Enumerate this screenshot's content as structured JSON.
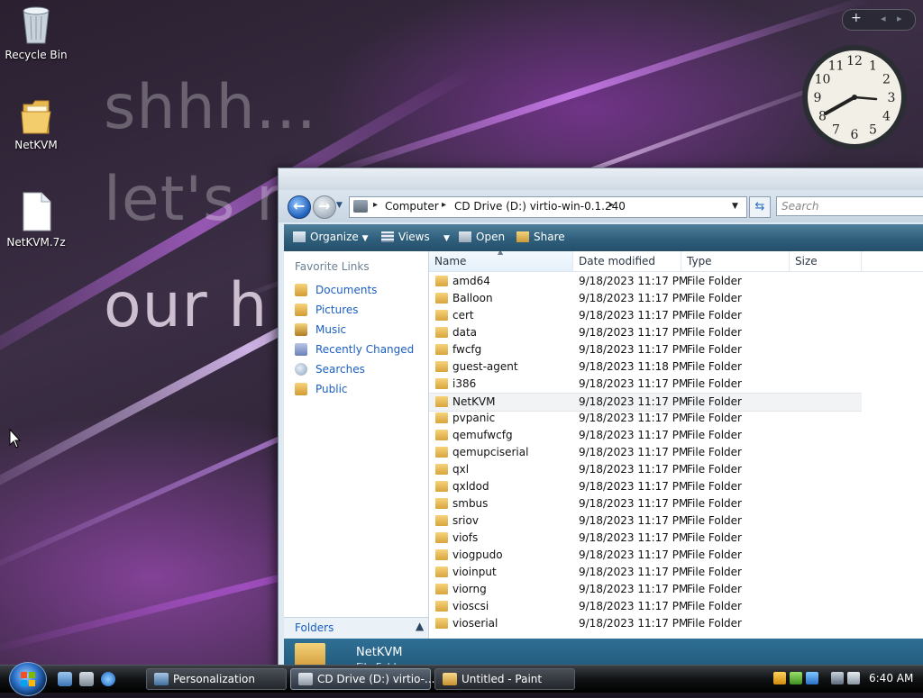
{
  "wallpaper": {
    "lines": [
      "shhh...",
      "let's n",
      "our h"
    ]
  },
  "desktop": {
    "icons": [
      {
        "label": "Recycle Bin",
        "icon": "recycle-bin-icon"
      },
      {
        "label": "NetKVM",
        "icon": "folder-icon"
      },
      {
        "label": "NetKVM.7z",
        "icon": "file-icon"
      }
    ]
  },
  "gadgets": {
    "bar": {
      "add": "+",
      "prev": "◂",
      "next": "▸"
    },
    "clock": {
      "numerals": [
        "12",
        "1",
        "2",
        "3",
        "4",
        "5",
        "6",
        "7",
        "8",
        "9",
        "10",
        "11"
      ]
    }
  },
  "explorer": {
    "address": {
      "root_icon": "computer-icon",
      "crumbs": [
        "Computer",
        "CD Drive (D:) virtio-win-0.1.240"
      ]
    },
    "search_placeholder": "Search",
    "toolbar": {
      "organize": "Organize",
      "views": "Views",
      "open": "Open",
      "share": "Share"
    },
    "nav_pane": {
      "section": "Favorite Links",
      "links": [
        {
          "label": "Documents",
          "icon": "documents-icon"
        },
        {
          "label": "Pictures",
          "icon": "pictures-icon"
        },
        {
          "label": "Music",
          "icon": "music-icon"
        },
        {
          "label": "Recently Changed",
          "icon": "recently-changed-icon"
        },
        {
          "label": "Searches",
          "icon": "searches-icon"
        },
        {
          "label": "Public",
          "icon": "public-icon"
        }
      ],
      "folders_label": "Folders"
    },
    "columns": [
      "Name",
      "Date modified",
      "Type",
      "Size"
    ],
    "files": [
      {
        "name": "amd64",
        "date": "9/18/2023 11:17 PM",
        "type": "File Folder"
      },
      {
        "name": "Balloon",
        "date": "9/18/2023 11:17 PM",
        "type": "File Folder"
      },
      {
        "name": "cert",
        "date": "9/18/2023 11:17 PM",
        "type": "File Folder"
      },
      {
        "name": "data",
        "date": "9/18/2023 11:17 PM",
        "type": "File Folder"
      },
      {
        "name": "fwcfg",
        "date": "9/18/2023 11:17 PM",
        "type": "File Folder"
      },
      {
        "name": "guest-agent",
        "date": "9/18/2023 11:18 PM",
        "type": "File Folder"
      },
      {
        "name": "i386",
        "date": "9/18/2023 11:17 PM",
        "type": "File Folder"
      },
      {
        "name": "NetKVM",
        "date": "9/18/2023 11:17 PM",
        "type": "File Folder",
        "selected": true
      },
      {
        "name": "pvpanic",
        "date": "9/18/2023 11:17 PM",
        "type": "File Folder"
      },
      {
        "name": "qemufwcfg",
        "date": "9/18/2023 11:17 PM",
        "type": "File Folder"
      },
      {
        "name": "qemupciserial",
        "date": "9/18/2023 11:17 PM",
        "type": "File Folder"
      },
      {
        "name": "qxl",
        "date": "9/18/2023 11:17 PM",
        "type": "File Folder"
      },
      {
        "name": "qxldod",
        "date": "9/18/2023 11:17 PM",
        "type": "File Folder"
      },
      {
        "name": "smbus",
        "date": "9/18/2023 11:17 PM",
        "type": "File Folder"
      },
      {
        "name": "sriov",
        "date": "9/18/2023 11:17 PM",
        "type": "File Folder"
      },
      {
        "name": "viofs",
        "date": "9/18/2023 11:17 PM",
        "type": "File Folder"
      },
      {
        "name": "viogpudo",
        "date": "9/18/2023 11:17 PM",
        "type": "File Folder"
      },
      {
        "name": "vioinput",
        "date": "9/18/2023 11:17 PM",
        "type": "File Folder"
      },
      {
        "name": "viorng",
        "date": "9/18/2023 11:17 PM",
        "type": "File Folder"
      },
      {
        "name": "vioscsi",
        "date": "9/18/2023 11:17 PM",
        "type": "File Folder"
      },
      {
        "name": "vioserial",
        "date": "9/18/2023 11:17 PM",
        "type": "File Folder"
      }
    ],
    "details": {
      "title": "NetKVM",
      "subtitle": "File Fold..."
    }
  },
  "taskbar": {
    "quick_launch": [
      "show-desktop-icon",
      "switch-windows-icon",
      "internet-explorer-icon"
    ],
    "tasks": [
      {
        "label": "Personalization",
        "icon": "personalization-icon"
      },
      {
        "label": "CD Drive (D:) virtio-...",
        "icon": "cd-drive-icon",
        "active": true
      },
      {
        "label": "Untitled - Paint",
        "icon": "paint-icon"
      }
    ],
    "tray_icons": [
      "security-shield-icon",
      "network-tray-icon",
      "windows-update-icon",
      "monitor-tray-icon",
      "volume-muted-icon"
    ],
    "time": "6:40 AM"
  }
}
